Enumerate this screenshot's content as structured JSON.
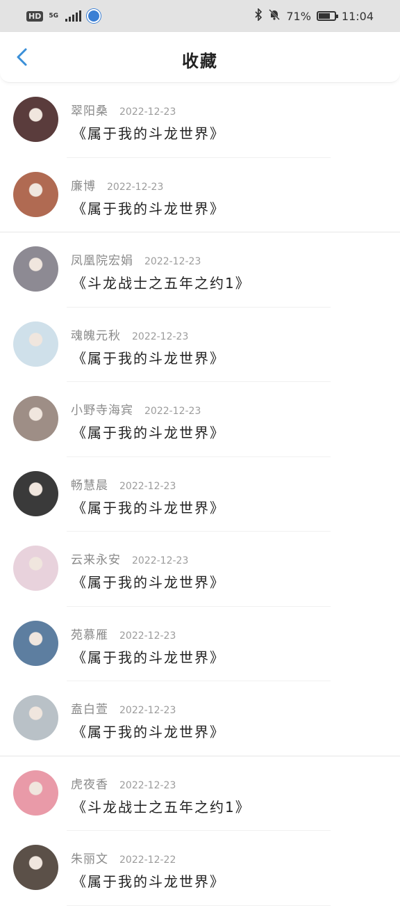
{
  "status_bar": {
    "hd": "HD",
    "network": "5G",
    "battery_text": "71%",
    "time": "11:04",
    "battery_level": 0.71
  },
  "header": {
    "title": "收藏"
  },
  "favorites": [
    {
      "name": "翠阳桑",
      "date": "2022-12-23",
      "title": "《属于我的斗龙世界》",
      "avatar_color": "#5a3c3c"
    },
    {
      "name": "廉博",
      "date": "2022-12-23",
      "title": "《属于我的斗龙世界》",
      "avatar_color": "#b06a52"
    },
    {
      "name": "凤凰院宏娟",
      "date": "2022-12-23",
      "title": "《斗龙战士之五年之约1》",
      "avatar_color": "#8d8a93"
    },
    {
      "name": "魂魄元秋",
      "date": "2022-12-23",
      "title": "《属于我的斗龙世界》",
      "avatar_color": "#cfe0ea"
    },
    {
      "name": "小野寺海宾",
      "date": "2022-12-23",
      "title": "《属于我的斗龙世界》",
      "avatar_color": "#9e8e86"
    },
    {
      "name": "畅慧晨",
      "date": "2022-12-23",
      "title": "《属于我的斗龙世界》",
      "avatar_color": "#3a3a3a"
    },
    {
      "name": "云来永安",
      "date": "2022-12-23",
      "title": "《属于我的斗龙世界》",
      "avatar_color": "#e8d2dc"
    },
    {
      "name": "苑慕雁",
      "date": "2022-12-23",
      "title": "《属于我的斗龙世界》",
      "avatar_color": "#5d7ea0"
    },
    {
      "name": "盍白萱",
      "date": "2022-12-23",
      "title": "《属于我的斗龙世界》",
      "avatar_color": "#b9c1c7"
    },
    {
      "name": "虎夜香",
      "date": "2022-12-23",
      "title": "《斗龙战士之五年之约1》",
      "avatar_color": "#e99aa8"
    },
    {
      "name": "朱丽文",
      "date": "2022-12-22",
      "title": "《属于我的斗龙世界》",
      "avatar_color": "#5b5048"
    }
  ]
}
